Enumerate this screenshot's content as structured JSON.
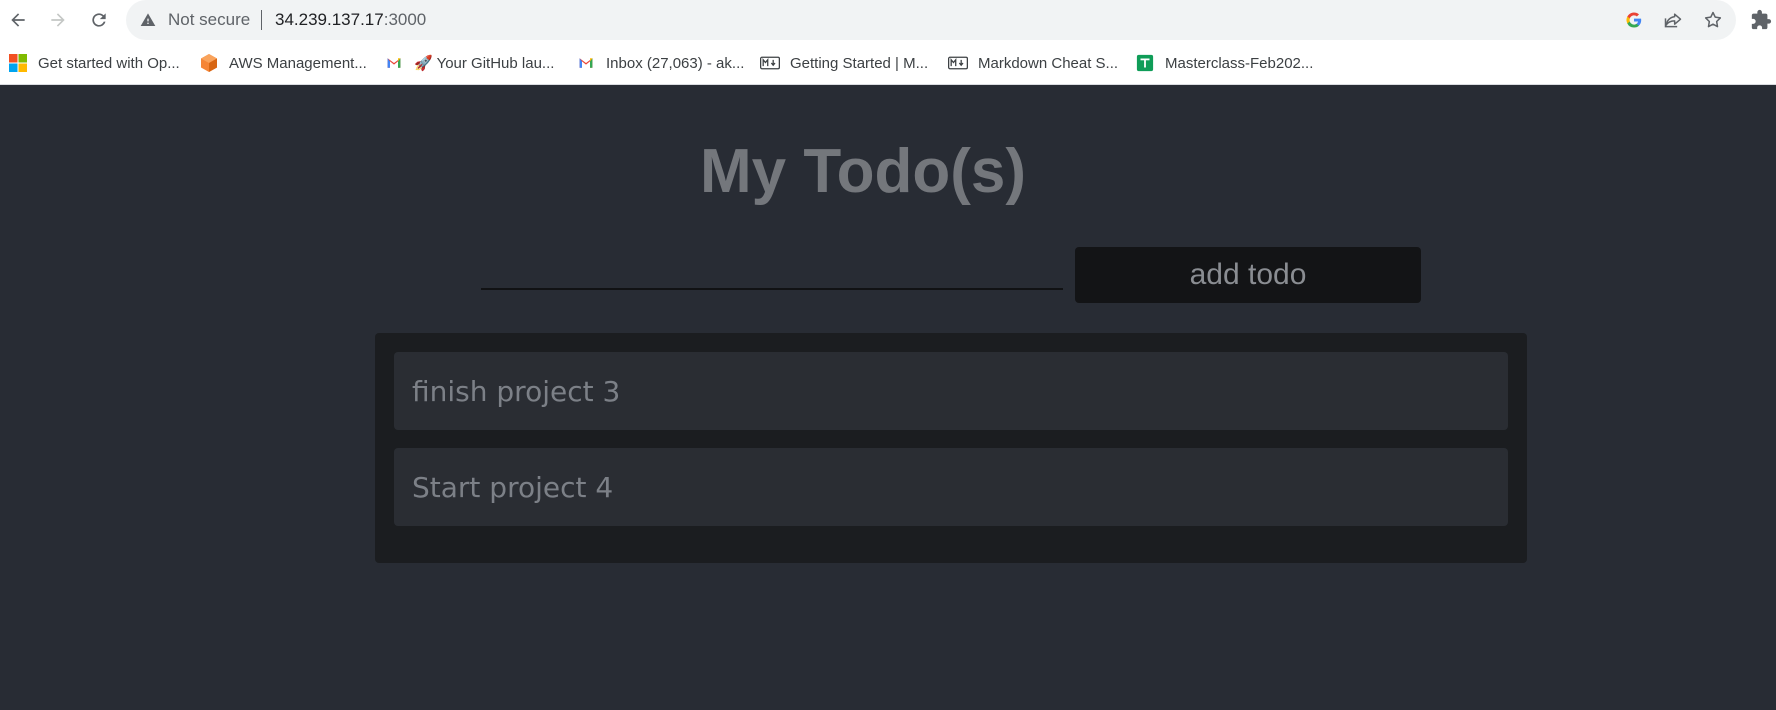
{
  "browser": {
    "security_label": "Not secure",
    "url_host": "34.239.137.17",
    "url_port": ":3000"
  },
  "bookmarks": [
    {
      "label": "Get started with Op...",
      "icon": "microsoft-icon"
    },
    {
      "label": "AWS Management...",
      "icon": "aws-icon"
    },
    {
      "label": "🚀 Your GitHub lau...",
      "icon": "gmail-icon"
    },
    {
      "label": "Inbox (27,063) - ak...",
      "icon": "gmail-icon"
    },
    {
      "label": "Getting Started | M...",
      "icon": "markdown-icon"
    },
    {
      "label": "Markdown Cheat S...",
      "icon": "markdown-icon"
    },
    {
      "label": "Masterclass-Feb202...",
      "icon": "google-sheets-icon"
    }
  ],
  "app": {
    "title": "My Todo(s)",
    "input_value": "",
    "add_button_label": "add todo",
    "todos": [
      {
        "text": "finish project 3"
      },
      {
        "text": "Start project 4"
      }
    ]
  },
  "colors": {
    "page_background": "#282c34",
    "list_background": "#1b1d20",
    "item_background": "#2a2d33",
    "title_text": "#74777c"
  }
}
